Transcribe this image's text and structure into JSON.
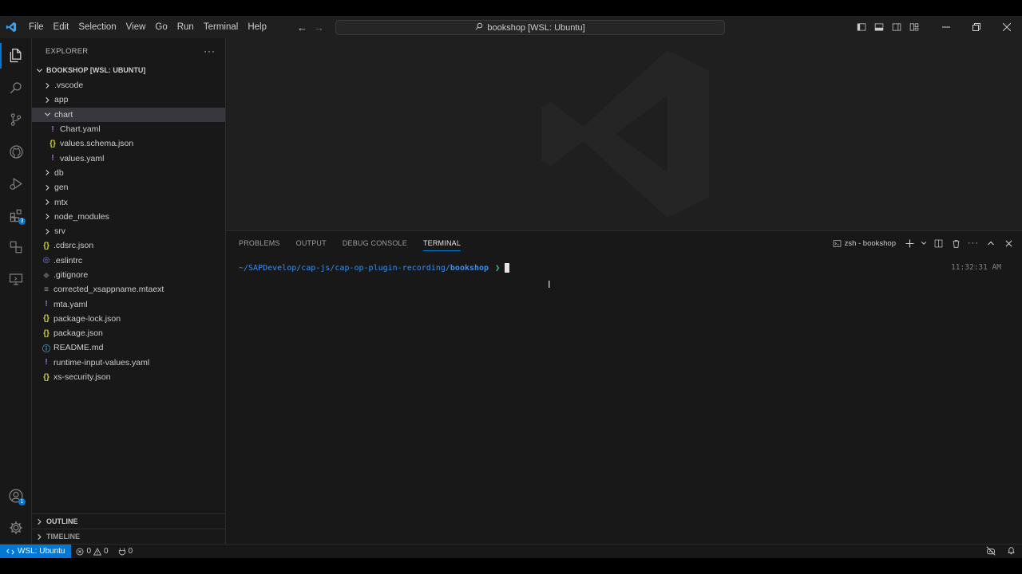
{
  "titlebar": {
    "menu": [
      "File",
      "Edit",
      "Selection",
      "View",
      "Go",
      "Run",
      "Terminal",
      "Help"
    ],
    "command_center": "bookshop [WSL: Ubuntu]"
  },
  "activity_bar": {
    "icons": [
      "explorer-icon",
      "search-icon",
      "source-control-icon",
      "github-icon",
      "run-debug-icon",
      "extensions-icon",
      "remote-explorer-icon",
      "ports-icon"
    ],
    "extensions_badge": "3",
    "accounts_badge": "1"
  },
  "sidebar": {
    "title": "EXPLORER",
    "workspace": "BOOKSHOP [WSL: UBUNTU]",
    "tree": [
      {
        "name": ".vscode",
        "type": "folder",
        "expanded": false
      },
      {
        "name": "app",
        "type": "folder",
        "expanded": false
      },
      {
        "name": "chart",
        "type": "folder",
        "expanded": true,
        "selected": true
      },
      {
        "name": "Chart.yaml",
        "type": "yaml",
        "indent": true
      },
      {
        "name": "values.schema.json",
        "type": "json",
        "indent": true
      },
      {
        "name": "values.yaml",
        "type": "yaml",
        "indent": true
      },
      {
        "name": "db",
        "type": "folder",
        "expanded": false
      },
      {
        "name": "gen",
        "type": "folder",
        "expanded": false
      },
      {
        "name": "mtx",
        "type": "folder",
        "expanded": false
      },
      {
        "name": "node_modules",
        "type": "folder",
        "expanded": false
      },
      {
        "name": "srv",
        "type": "folder",
        "expanded": false
      },
      {
        "name": ".cdsrc.json",
        "type": "json"
      },
      {
        "name": ".eslintrc",
        "type": "eslint"
      },
      {
        "name": ".gitignore",
        "type": "git"
      },
      {
        "name": "corrected_xsappname.mtaext",
        "type": "text"
      },
      {
        "name": "mta.yaml",
        "type": "yaml"
      },
      {
        "name": "package-lock.json",
        "type": "json"
      },
      {
        "name": "package.json",
        "type": "json"
      },
      {
        "name": "README.md",
        "type": "info"
      },
      {
        "name": "runtime-input-values.yaml",
        "type": "yaml"
      },
      {
        "name": "xs-security.json",
        "type": "json"
      }
    ],
    "outline": "OUTLINE",
    "timeline": "TIMELINE"
  },
  "panel": {
    "tabs": [
      "PROBLEMS",
      "OUTPUT",
      "DEBUG CONSOLE",
      "TERMINAL"
    ],
    "active_tab": "TERMINAL",
    "terminal_name": "zsh - bookshop",
    "prompt_path": "~/SAPDevelop/cap-js/cap-op-plugin-recording/",
    "prompt_dir": "bookshop",
    "prompt_arrow": "❯",
    "time": "11:32:31 AM"
  },
  "statusbar": {
    "remote": "WSL: Ubuntu",
    "errors": "0",
    "warnings": "0",
    "ports": "0"
  },
  "colors": {
    "accent": "#0078d4",
    "folder_text": "#cccccc",
    "json_icon": "#cbcb41",
    "yaml_icon": "#a074c4",
    "prompt_path": "#3b8eea",
    "prompt_arrow": "#23d18b"
  }
}
